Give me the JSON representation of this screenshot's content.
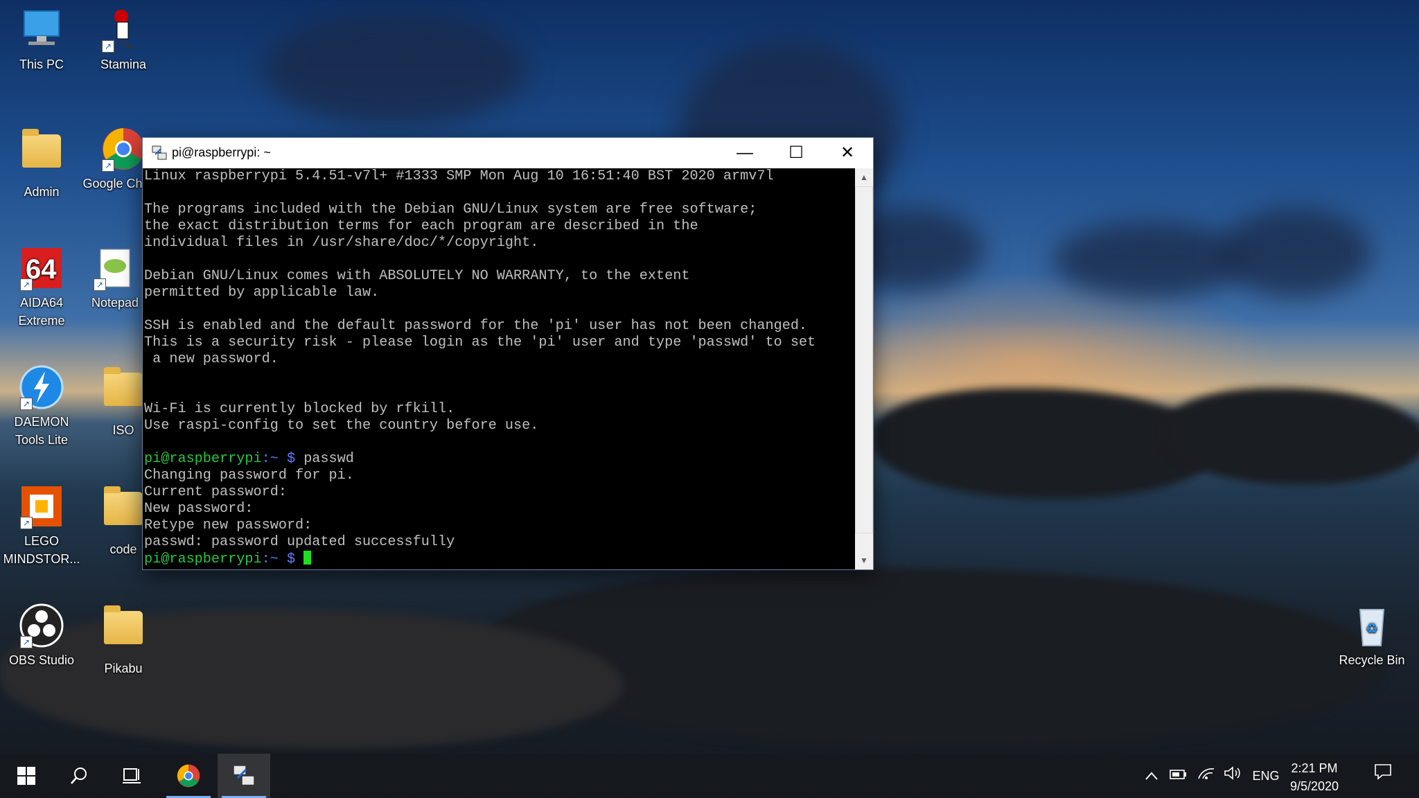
{
  "desktop": {
    "icons": [
      {
        "label": "This PC",
        "icon": "this-pc-icon"
      },
      {
        "label": "Stamina",
        "icon": "stamina-icon"
      },
      {
        "label": "Admin",
        "icon": "user-folder-icon"
      },
      {
        "label": "Google Chrom",
        "icon": "chrome-icon"
      },
      {
        "label": "AIDA64 Extreme",
        "icon": "aida64-icon"
      },
      {
        "label": "Notepad",
        "icon": "notepad-icon"
      },
      {
        "label": "DAEMON Tools Lite",
        "icon": "daemon-tools-icon"
      },
      {
        "label": "ISO",
        "icon": "folder-icon"
      },
      {
        "label": "LEGO MINDSTOR...",
        "icon": "lego-mindstorms-icon"
      },
      {
        "label": "code",
        "icon": "folder-icon"
      },
      {
        "label": "OBS Studio",
        "icon": "obs-icon"
      },
      {
        "label": "Pikabu",
        "icon": "folder-icon"
      },
      {
        "label": "Recycle Bin",
        "icon": "recycle-bin-icon"
      }
    ]
  },
  "terminal": {
    "title": "pi@raspberrypi: ~",
    "lines": [
      "Linux raspberrypi 5.4.51-v7l+ #1333 SMP Mon Aug 10 16:51:40 BST 2020 armv7l",
      "",
      "The programs included with the Debian GNU/Linux system are free software;",
      "the exact distribution terms for each program are described in the",
      "individual files in /usr/share/doc/*/copyright.",
      "",
      "Debian GNU/Linux comes with ABSOLUTELY NO WARRANTY, to the extent",
      "permitted by applicable law.",
      "",
      "SSH is enabled and the default password for the 'pi' user has not been changed.",
      "This is a security risk - please login as the 'pi' user and type 'passwd' to set",
      " a new password.",
      "",
      "",
      "Wi-Fi is currently blocked by rfkill.",
      "Use raspi-config to set the country before use.",
      ""
    ],
    "prompt_user": "pi@raspberrypi",
    "prompt_path": ":~ $",
    "command": " passwd",
    "output_lines": [
      "Changing password for pi.",
      "Current password:",
      "New password:",
      "Retype new password:",
      "passwd: password updated successfully"
    ]
  },
  "taskbar": {
    "items": [
      "start-icon",
      "search-icon",
      "task-view-icon",
      "chrome-icon",
      "putty-icon"
    ],
    "language": "ENG",
    "time": "2:21 PM",
    "date": "9/5/2020"
  }
}
